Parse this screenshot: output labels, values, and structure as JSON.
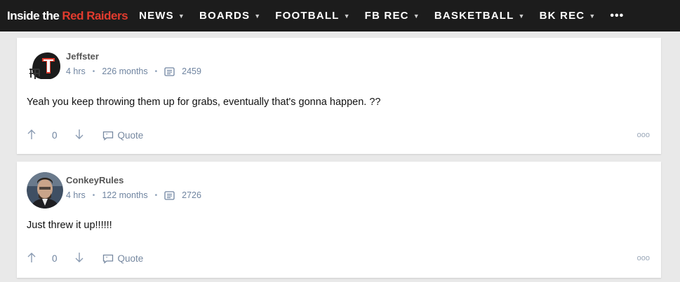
{
  "site": {
    "logo_part1": "Inside the",
    "logo_part2": "Red Raiders"
  },
  "nav": {
    "items": [
      {
        "label": "NEWS"
      },
      {
        "label": "BOARDS"
      },
      {
        "label": "FOOTBALL"
      },
      {
        "label": "FB REC"
      },
      {
        "label": "BASKETBALL"
      },
      {
        "label": "BK REC"
      }
    ],
    "more": "•••"
  },
  "posts": [
    {
      "username": "Jeffster",
      "time": "4 hrs",
      "tenure": "226 months",
      "post_count": "2459",
      "body": "Yeah you keep throwing them up for grabs, eventually that's gonna happen. ??",
      "votes": "0",
      "quote_label": "Quote",
      "overflow": "ooo"
    },
    {
      "username": "ConkeyRules",
      "time": "4 hrs",
      "tenure": "122 months",
      "post_count": "2726",
      "body": "Just threw it up!!!!!!",
      "votes": "0",
      "quote_label": "Quote",
      "overflow": "ooo"
    }
  ],
  "colors": {
    "nav_bg": "#1c1c1c",
    "accent_red": "#e23b2e",
    "meta_blue": "#6f84a0"
  }
}
